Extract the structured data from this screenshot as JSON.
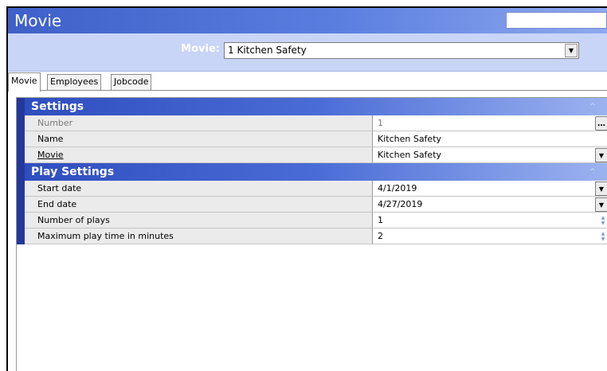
{
  "window": {
    "title": "Movie"
  },
  "selector": {
    "label": "Movie:",
    "value": "1 Kitchen Safety"
  },
  "tabs": [
    {
      "label": "Movie",
      "active": true
    },
    {
      "label": "Employees",
      "active": false
    },
    {
      "label": "Jobcode",
      "active": false
    }
  ],
  "sections": {
    "settings": {
      "title": "Settings",
      "rows": [
        {
          "label": "Number",
          "value": "1"
        },
        {
          "label": "Name",
          "value": "Kitchen Safety"
        },
        {
          "label": "Movie",
          "value": "Kitchen Safety"
        }
      ]
    },
    "play_settings": {
      "title": "Play Settings",
      "rows": [
        {
          "label": "Start date",
          "value": "4/1/2019"
        },
        {
          "label": "End date",
          "value": "4/27/2019"
        },
        {
          "label": "Number of plays",
          "value": "1"
        },
        {
          "label": "Maximum play time in minutes",
          "value": "2"
        }
      ]
    }
  },
  "icons": {
    "collapse": "double-chevron-up-icon",
    "dropdown": "triangle-down-icon",
    "ellipsis": "ellipsis-icon",
    "spinner": "spinner-icon"
  },
  "colors": {
    "title_bar": "#3e60c8",
    "selector_bar": "#c8d5f7",
    "section_header": "#2f4ebf",
    "section_marker": "#24389c"
  }
}
